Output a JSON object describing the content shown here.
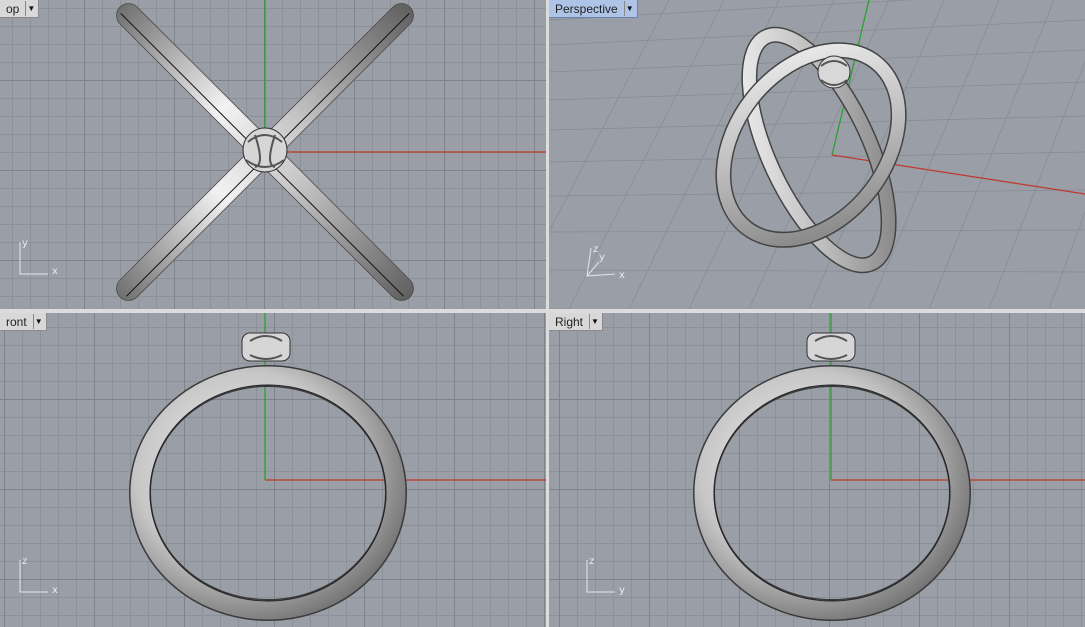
{
  "viewports": {
    "top": {
      "label": "op",
      "axis_a": "y",
      "axis_b": "x"
    },
    "persp": {
      "label": "Perspective",
      "axis_a": "z",
      "axis_b": "y",
      "axis_c": "x"
    },
    "front": {
      "label": "ront",
      "axis_a": "z",
      "axis_b": "x"
    },
    "right": {
      "label": "Right",
      "axis_a": "z",
      "axis_b": "y"
    }
  },
  "icons": {
    "dropdown": "triangle-down-icon"
  },
  "colors": {
    "x_axis": "#c0392b",
    "y_axis": "#22a32a",
    "grid_major": "#7e828a",
    "grid_minor": "#8c9098",
    "background": "#9a9ea6"
  }
}
